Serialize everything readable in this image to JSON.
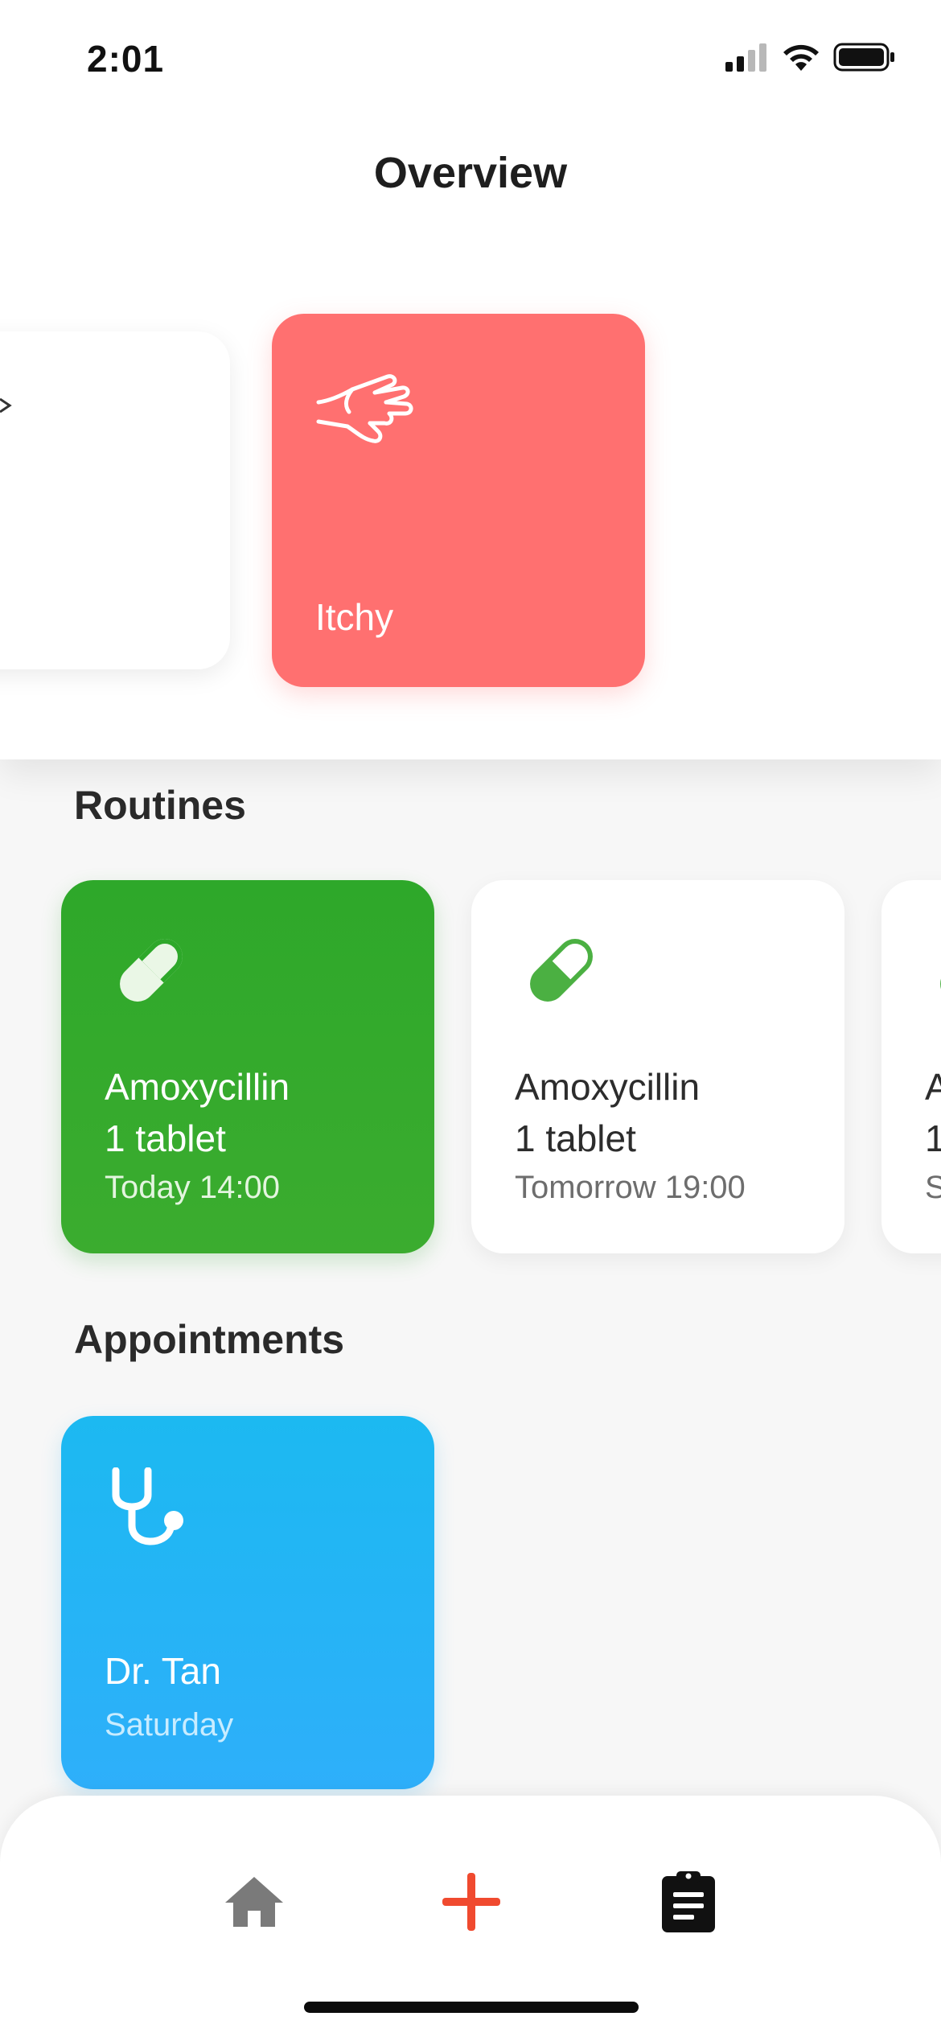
{
  "status_bar": {
    "time": "2:01"
  },
  "header": {
    "title": "Overview"
  },
  "symptoms": {
    "items": [
      {
        "label": "",
        "icon": "arrow-icon",
        "partially_visible": true
      },
      {
        "label": "Itchy",
        "icon": "hand-scratch-icon",
        "color": "#ff7070"
      }
    ]
  },
  "routines": {
    "heading": "Routines",
    "items": [
      {
        "name": "Amoxycillin",
        "dose": "1 tablet",
        "time": "Today 14:00",
        "icon": "pill-icon",
        "color": "#2ea82a",
        "state": "active"
      },
      {
        "name": "Amoxycillin",
        "dose": "1 tablet",
        "time": "Tomorrow 19:00",
        "icon": "pill-icon",
        "state": "upcoming"
      },
      {
        "name": "A",
        "dose": "1",
        "time": "S",
        "icon": "pill-icon",
        "partially_visible": true
      }
    ]
  },
  "appointments": {
    "heading": "Appointments",
    "items": [
      {
        "name": "Dr. Tan",
        "day": "Saturday",
        "icon": "stethoscope-icon",
        "color": "#1cb9f1"
      }
    ]
  },
  "tab_bar": {
    "items": [
      {
        "name": "home",
        "icon": "home-icon",
        "color": "#7a7a7a"
      },
      {
        "name": "add",
        "icon": "plus-icon",
        "color": "#f04a2f"
      },
      {
        "name": "records",
        "icon": "clipboard-icon",
        "color": "#111111",
        "selected": true
      }
    ]
  }
}
